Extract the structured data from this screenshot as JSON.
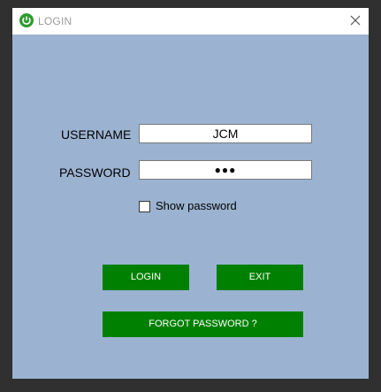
{
  "window": {
    "title": "LOGIN",
    "app_icon": "power-icon",
    "close_icon": "close-icon",
    "background_color": "#9bb3d1"
  },
  "form": {
    "username_label": "USERNAME",
    "username_value": "JCM",
    "password_label": "PASSWORD",
    "password_value": "●●●",
    "show_password_label": "Show password",
    "show_password_checked": false
  },
  "buttons": {
    "login_label": "LOGIN",
    "exit_label": "EXIT",
    "forgot_label": "FORGOT PASSWORD ?",
    "color": "#008000"
  }
}
